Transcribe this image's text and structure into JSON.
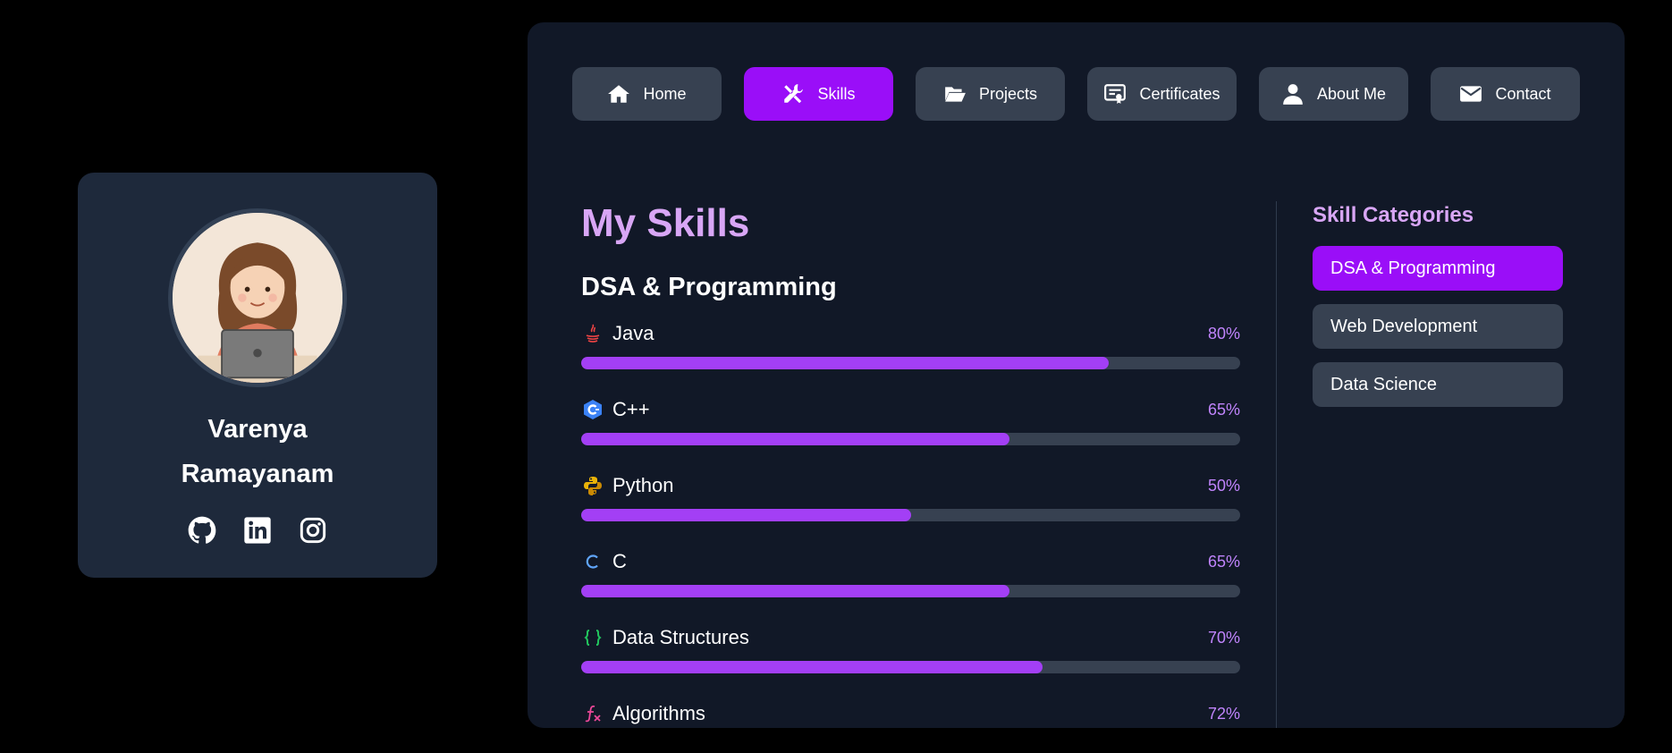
{
  "profile": {
    "name": "Varenya Ramayanam",
    "socials": [
      "github-icon",
      "linkedin-icon",
      "instagram-icon"
    ]
  },
  "nav": [
    {
      "label": "Home",
      "icon": "home-icon",
      "active": false
    },
    {
      "label": "Skills",
      "icon": "tools-icon",
      "active": true
    },
    {
      "label": "Projects",
      "icon": "folder-open-icon",
      "active": false
    },
    {
      "label": "Certificates",
      "icon": "certificate-icon",
      "active": false
    },
    {
      "label": "About Me",
      "icon": "user-icon",
      "active": false
    },
    {
      "label": "Contact",
      "icon": "envelope-icon",
      "active": false
    }
  ],
  "skills": {
    "title": "My Skills",
    "section": "DSA & Programming",
    "items": [
      {
        "name": "Java",
        "percent": "80%",
        "level": 0.8,
        "icon": "java-icon",
        "icon_color": "#ef4444"
      },
      {
        "name": "C++",
        "percent": "65%",
        "level": 0.65,
        "icon": "cpp-icon",
        "icon_color": "#3b82f6"
      },
      {
        "name": "Python",
        "percent": "50%",
        "level": 0.5,
        "icon": "python-icon",
        "icon_color": "#eab308"
      },
      {
        "name": "C",
        "percent": "65%",
        "level": 0.65,
        "icon": "c-icon",
        "icon_color": "#60a5fa"
      },
      {
        "name": "Data Structures",
        "percent": "70%",
        "level": 0.7,
        "icon": "braces-icon",
        "icon_color": "#22c55e"
      },
      {
        "name": "Algorithms",
        "percent": "72%",
        "level": 0.72,
        "icon": "function-icon",
        "icon_color": "#ec4899"
      }
    ]
  },
  "categories": {
    "title": "Skill Categories",
    "items": [
      {
        "label": "DSA & Programming",
        "active": true
      },
      {
        "label": "Web Development",
        "active": false
      },
      {
        "label": "Data Science",
        "active": false
      }
    ]
  },
  "colors": {
    "accent": "#9a0ef8",
    "bar_fill": "#a33ff5",
    "heading": "#d8a6f5",
    "percent": "#c084fc"
  }
}
